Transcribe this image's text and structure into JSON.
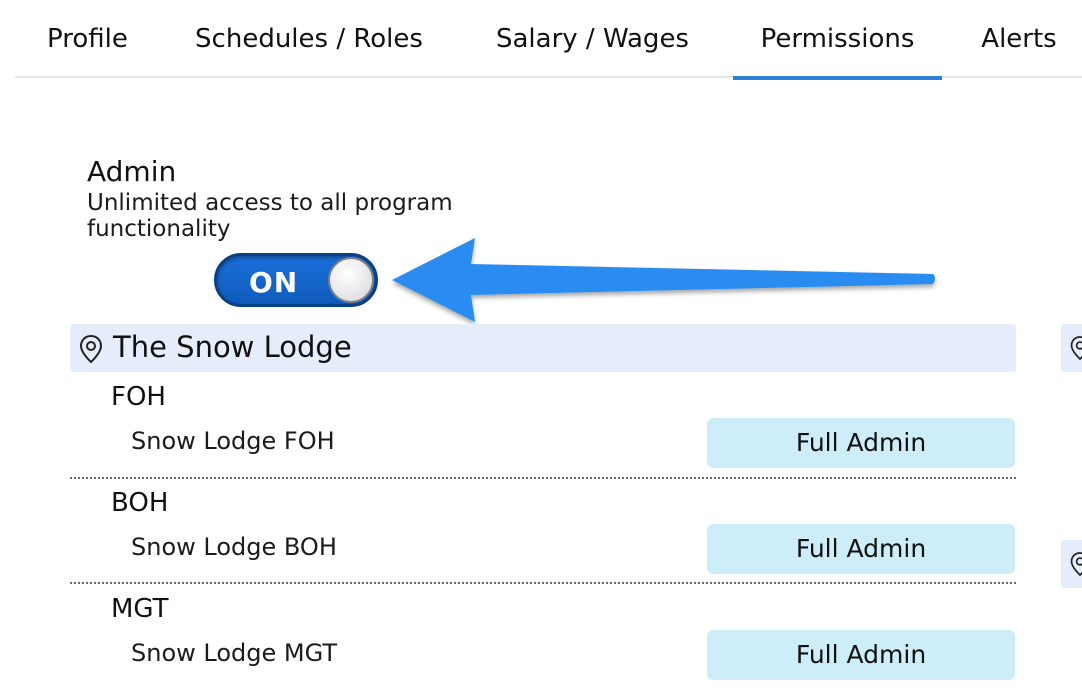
{
  "tabs": [
    {
      "label": "Profile"
    },
    {
      "label": "Schedules / Roles"
    },
    {
      "label": "Salary / Wages"
    },
    {
      "label": "Permissions",
      "active": true
    },
    {
      "label": "Alerts"
    }
  ],
  "admin": {
    "title": "Admin",
    "description": "Unlimited access to all program functionality",
    "toggle_label": "ON",
    "toggle_on": true
  },
  "location": {
    "name": "The Snow Lodge",
    "icon": "map-pin-icon"
  },
  "groups": [
    {
      "name": "FOH",
      "role": "Snow Lodge FOH",
      "permission": "Full Admin"
    },
    {
      "name": "BOH",
      "role": "Snow Lodge BOH",
      "permission": "Full Admin"
    },
    {
      "name": "MGT",
      "role": "Snow Lodge MGT",
      "permission": "Full Admin"
    }
  ],
  "colors": {
    "accent": "#2f80d8",
    "toggle_on": "#1565cf",
    "location_header_bg": "#e6eefc",
    "permission_button_bg": "#cdeef9",
    "annotation_arrow": "#2a8cf0"
  }
}
